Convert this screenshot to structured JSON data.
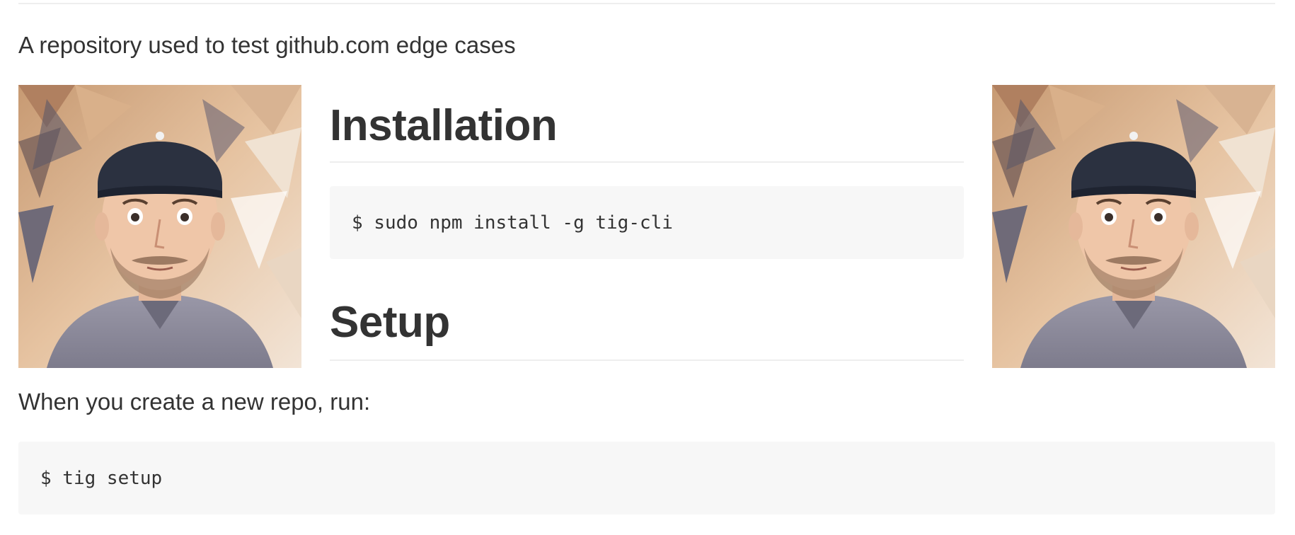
{
  "readme": {
    "description": "A repository used to test github.com edge cases",
    "images": {
      "left_alt": "portrait photo",
      "right_alt": "portrait photo"
    },
    "installation": {
      "heading": "Installation",
      "command": "$ sudo npm install -g tig-cli"
    },
    "setup": {
      "heading": "Setup",
      "instruction": "When you create a new repo, run:",
      "command": "$ tig setup"
    }
  },
  "colors": {
    "text": "#333333",
    "code_background": "#f7f7f7",
    "rule": "#eeeeee"
  }
}
